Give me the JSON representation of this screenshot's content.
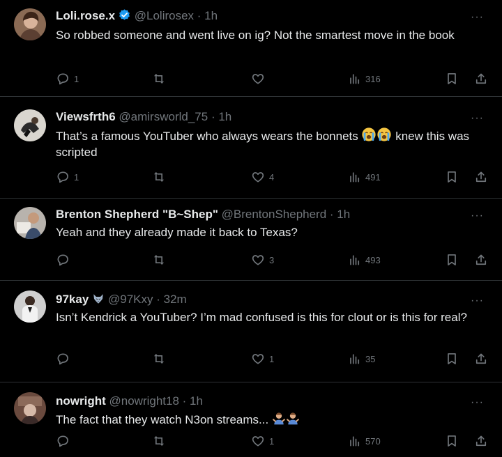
{
  "replies": [
    {
      "name": "Loli.rose.x",
      "handle": "@Lolirosex",
      "time": "· 1h",
      "text": "So robbed someone and went live on ig? Not the smartest move in the book",
      "replies": "1",
      "reposts": "",
      "likes": "",
      "views": "316",
      "verified": true
    },
    {
      "name": "Viewsfrth6",
      "handle": "@amirsworld_75",
      "time": "· 1h",
      "text_before": "That’s a famous YouTuber who always wears the bonnets ",
      "text_after": " knew this was scripted",
      "replies": "1",
      "reposts": "",
      "likes": "4",
      "views": "491"
    },
    {
      "name": "Brenton Shepherd \"B~Shep\"",
      "handle": "@BrentonShepherd",
      "time": "· 1h",
      "text": "Yeah and they already made it back to Texas?",
      "replies": "",
      "reposts": "",
      "likes": "3",
      "views": "493"
    },
    {
      "name": "97kay",
      "handle": "@97Kxy",
      "time": "· 32m",
      "text": "Isn’t Kendrick a YouTuber? I’m mad confused is this for clout or is this for real?",
      "replies": "",
      "reposts": "",
      "likes": "1",
      "views": "35"
    },
    {
      "name": "nowright",
      "handle": "@nowright18",
      "time": "· 1h",
      "text": "The fact that they watch N3on streams...",
      "replies": "",
      "reposts": "",
      "likes": "1",
      "views": "570"
    }
  ],
  "more_label": "···",
  "icons": {
    "reply": "speech-bubble-icon",
    "repost": "repost-arrows-icon",
    "like": "heart-icon",
    "views": "bar-chart-icon",
    "bookmark": "bookmark-icon",
    "share": "share-upload-icon",
    "verified": "verified-badge-icon",
    "crying_emoji": "loudly-crying-face-icon",
    "shrug_emoji": "person-shrugging-icon",
    "wolf_emoji": "wolf-face-icon"
  },
  "colors": {
    "background": "#000000",
    "text": "#e7e9ea",
    "muted": "#71767b",
    "divider": "#2f3336",
    "verified": "#1d9bf0"
  }
}
